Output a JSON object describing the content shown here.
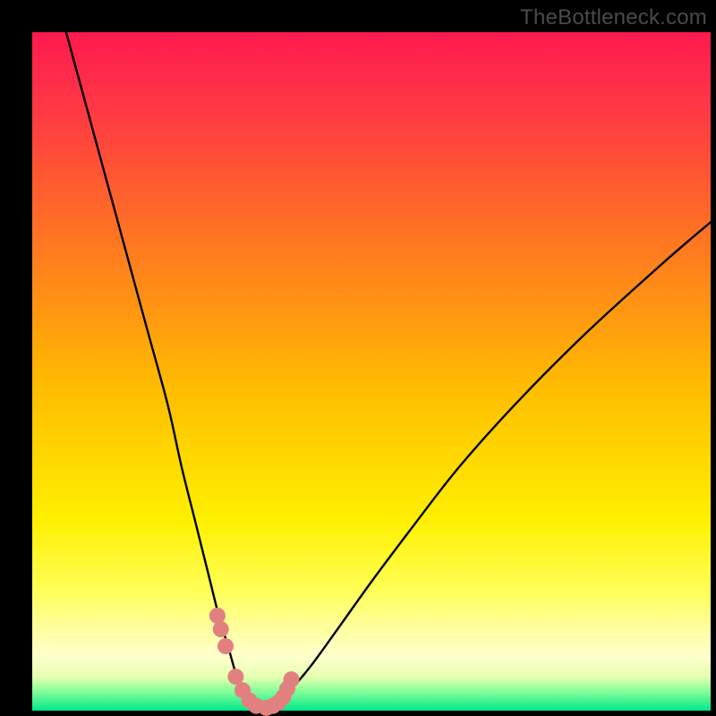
{
  "watermark": "TheBottleneck.com",
  "colors": {
    "background": "#000000",
    "curve": "#000000",
    "marker_fill": "#e28080",
    "marker_stroke": "#c86868",
    "gradient_top": "#ff1a4d",
    "gradient_bottom": "#00e88a"
  },
  "chart_data": {
    "type": "line",
    "title": "",
    "xlabel": "",
    "ylabel": "",
    "xlim": [
      0,
      100
    ],
    "ylim": [
      0,
      100
    ],
    "series": [
      {
        "name": "bottleneck-curve",
        "x": [
          5,
          8,
          11,
          14,
          17,
          20,
          22,
          24,
          26,
          27.5,
          29,
          30,
          31,
          32,
          33,
          34,
          35,
          36,
          38,
          41,
          45,
          50,
          56,
          63,
          72,
          82,
          93,
          100
        ],
        "values": [
          100,
          89,
          78,
          67,
          56,
          45,
          36,
          28,
          20,
          14,
          9,
          5.5,
          3,
          1.5,
          0.7,
          0.3,
          0.6,
          1.3,
          3,
          6.5,
          12,
          19,
          27,
          36,
          46,
          56,
          66,
          72
        ]
      }
    ],
    "markers": {
      "name": "highlighted-points",
      "x": [
        27.3,
        27.8,
        28.5,
        30.0,
        31.0,
        32.0,
        33.0,
        34.5,
        35.5,
        36.3,
        37.0,
        37.6,
        38.2
      ],
      "values": [
        14.0,
        12.0,
        9.5,
        5.0,
        3.0,
        1.5,
        0.7,
        0.4,
        0.7,
        1.2,
        2.0,
        3.2,
        4.6
      ]
    }
  }
}
